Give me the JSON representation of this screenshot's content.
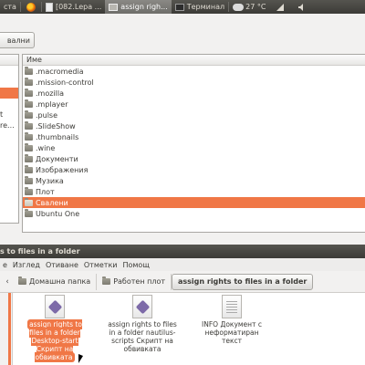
{
  "top_panel": {
    "app_fragment": "ста",
    "tab1": "[082.Lepa ...",
    "tab2": "assign righ...",
    "tab3": "Терминал",
    "temperature": "27 °C"
  },
  "dialog": {
    "path_button": "вални",
    "places_items": [
      "",
      "",
      "",
      "",
      "t",
      "re...",
      "",
      "",
      "",
      ""
    ],
    "column_header": "Име",
    "files": [
      ".macromedia",
      ".mission-control",
      ".mozilla",
      ".mplayer",
      ".pulse",
      ".SlideShow",
      ".thumbnails",
      ".wine",
      "Документи",
      "Изображения",
      "Музика",
      "Плот",
      "Свалени",
      "Ubuntu One"
    ],
    "selected_index": 12
  },
  "nautilus": {
    "title": "s to files in a folder",
    "menu": [
      "е",
      "Изглед",
      "Отиване",
      "Отметки",
      "Помощ"
    ],
    "breadcrumbs": [
      "Домашна папка",
      "Работен плот",
      "assign rights to files in a folder"
    ],
    "items": [
      {
        "label": "assign rights to files in a folder Desktop-start Скрипт на обвивката",
        "selected": true
      },
      {
        "label": "assign rights to files in a folder nautilus-scripts Скрипт на обвивката",
        "selected": false
      },
      {
        "label": "INFO Документ с неформатиран текст",
        "selected": false
      }
    ]
  }
}
